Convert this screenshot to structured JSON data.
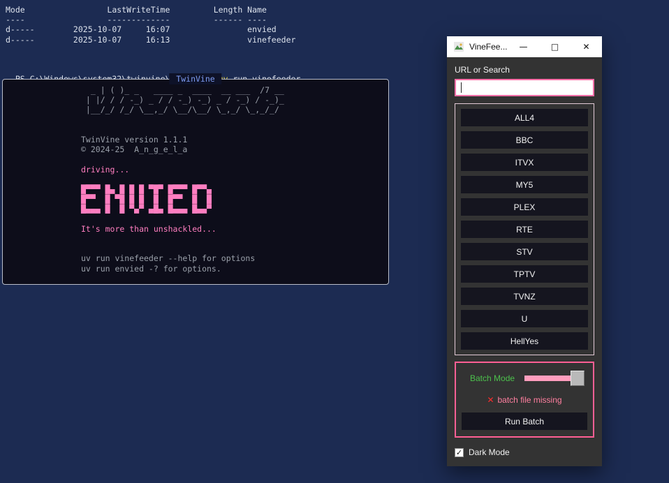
{
  "colors": {
    "bg_navy": "#1c2b52",
    "term_text": "#dce2ec",
    "cmd_yellow": "#e8d44d",
    "panel_bg": "#0d0d1a",
    "panel_border": "#b9bdc9",
    "panel_title_bg": "#0e1228",
    "panel_title_blue": "#7d9bf0",
    "panel_gray": "#9aa0aa",
    "pink": "#ff7ec0",
    "titlebar_bg": "#ffffff",
    "titlebar_text": "#111111",
    "app_bg": "#333333",
    "app_text": "#f2f2f2",
    "btn_bg": "#15151f",
    "input_border": "#ff6fa8",
    "services_border": "#e3cbd6",
    "batch_border": "#ff5f94",
    "green": "#4cc04c",
    "error_red": "#ff2d2d",
    "status_pink": "#ff7f9f",
    "slider_track": "#ff9dbd",
    "slider_handle": "#b9b9b9"
  },
  "terminal": {
    "listing": {
      "header": "Mode                 LastWriteTime         Length Name",
      "separator": "----                 -------------         ------ ----",
      "rows": [
        "d-----        2025-10-07     16:07                envied",
        "d-----        2025-10-07     16:13                vinefeeder"
      ]
    },
    "prompt": "PS C:\\Windows\\system32\\twinvine\\packages> ",
    "command": "uv",
    "args": " run vinefeeder"
  },
  "panel": {
    "title": "TwinVine",
    "ascii_art": [
      "  _ | ( )_ _   ____ _  ____  __ ___  /7 __",
      " | |/ / / -_) _ / / -_) -_) _ / -_) / -_)_",
      " |__/_/ /_/ \\__,_/ \\__/\\__/ \\_,_/ \\_,_/_/"
    ],
    "version_line": "TwinVine version 1.1.1",
    "copyright_line": "© 2024-25  A_n_g_e_l_a",
    "driving_line": "driving...",
    "envied_art": [
      "█▀▀▀ █▄ █ █ █ ▀█▀ █▀▀▀ █▀▀▄",
      "█▀▀  █ ▀█ █ █  █  █▀▀  █  █",
      "█▄▄▄ █  █ ▀▄▀ ▄█▄ █▄▄▄ █▄▄▀"
    ],
    "tagline": "It's more than unshackled...",
    "help_lines": [
      "uv run vinefeeder --help for options",
      "uv run envied -? for options."
    ]
  },
  "app_window": {
    "title": "VineFee...",
    "controls": {
      "minimize": "—",
      "maximize": "□",
      "close": "✕"
    },
    "url_label": "URL or Search",
    "url_value": "",
    "services": [
      "ALL4",
      "BBC",
      "ITVX",
      "MY5",
      "PLEX",
      "RTE",
      "STV",
      "TPTV",
      "TVNZ",
      "U",
      "HellYes"
    ],
    "batch": {
      "label": "Batch Mode",
      "status_icon": "✕",
      "status_text": "batch file missing",
      "run_button": "Run Batch"
    },
    "dark_mode": {
      "check": "✓",
      "label": "Dark Mode"
    }
  }
}
